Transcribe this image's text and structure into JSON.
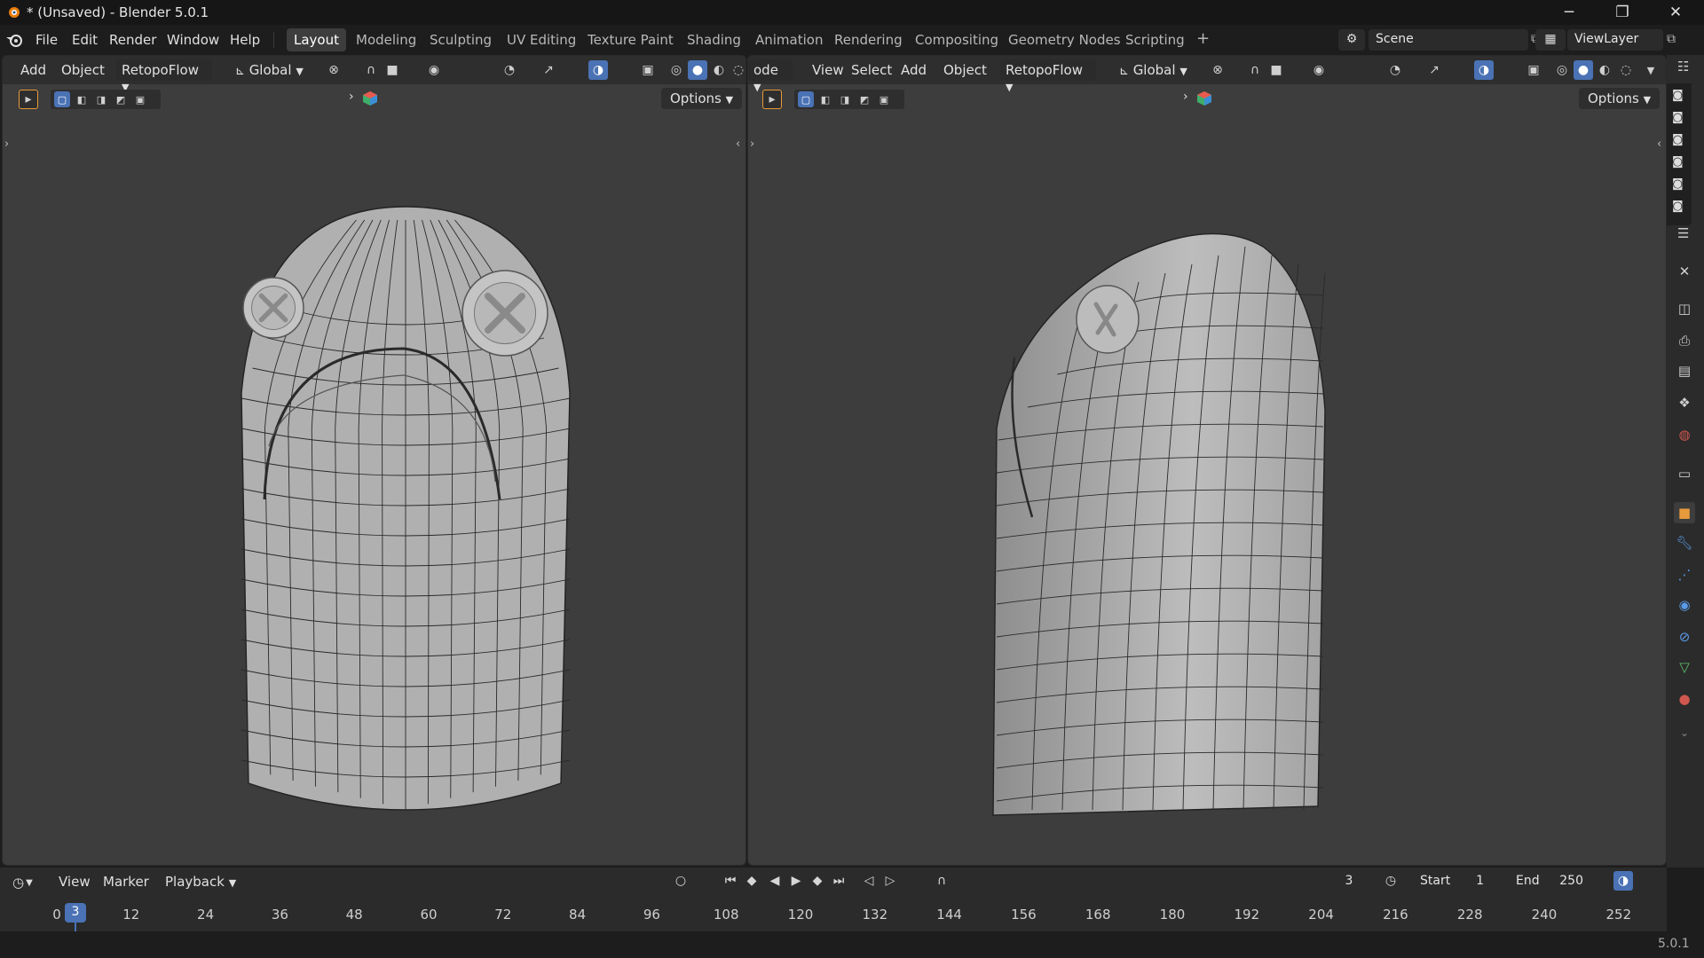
{
  "window": {
    "title": "* (Unsaved) - Blender 5.0.1",
    "minimize": "─",
    "restore": "❐",
    "close": "✕"
  },
  "menu": {
    "file": "File",
    "edit": "Edit",
    "render": "Render",
    "window": "Window",
    "help": "Help"
  },
  "workspaces": [
    "Layout",
    "Modeling",
    "Sculpting",
    "UV Editing",
    "Texture Paint",
    "Shading",
    "Animation",
    "Rendering",
    "Compositing",
    "Geometry Nodes",
    "Scripting"
  ],
  "workspace_add": "+",
  "scene": {
    "name": "Scene"
  },
  "view_layer": {
    "name": "ViewLayer"
  },
  "left_viewport": {
    "menus": {
      "add": "Add",
      "object": "Object"
    },
    "addon": "RetopoFlow",
    "orientation": "Global",
    "options": "Options",
    "mesh": {
      "polys": 18,
      "rings": 17,
      "ring_pts": 14
    }
  },
  "right_viewport": {
    "mode": "ode",
    "menus": {
      "view": "View",
      "select": "Select",
      "add": "Add",
      "object": "Object"
    },
    "addon": "RetopoFlow",
    "orientation": "Global",
    "options": "Options"
  },
  "timeline": {
    "menus": {
      "view": "View",
      "marker": "Marker",
      "playback": "Playback"
    },
    "current_frame": "3",
    "start_label": "Start",
    "start": "1",
    "end_label": "End",
    "end": "250",
    "ticks": [
      "0",
      "12",
      "24",
      "36",
      "48",
      "60",
      "72",
      "84",
      "96",
      "108",
      "120",
      "132",
      "144",
      "156",
      "168",
      "180",
      "192",
      "204",
      "216",
      "228",
      "240",
      "252"
    ],
    "frame_marker": "3"
  },
  "status": {
    "version": "5.0.1"
  },
  "colors": {
    "accent": "#4a72b5",
    "viewport_bg": "#3d3d3d",
    "header": "#2e2e2e",
    "mesh": "#b4b4b4"
  }
}
